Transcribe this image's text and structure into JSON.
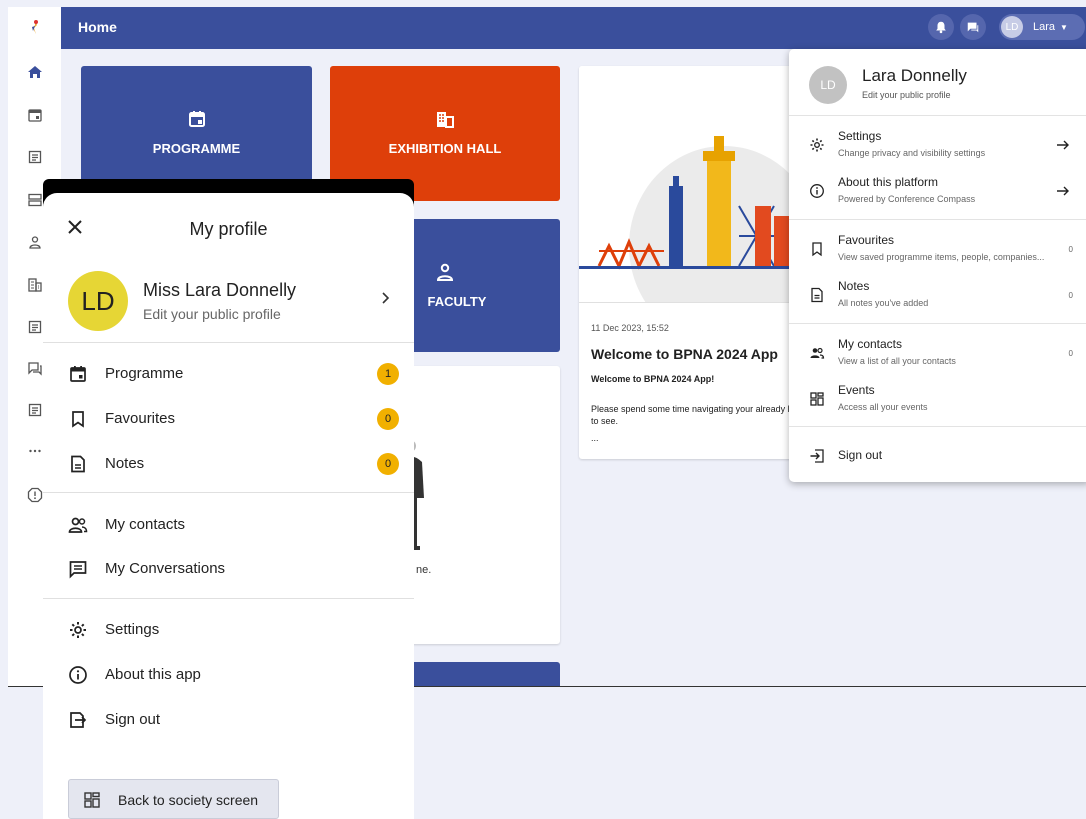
{
  "header": {
    "title": "Home",
    "user_initials": "LD",
    "user_name": "Lara"
  },
  "sidebar": {
    "items": [
      "logo-icon",
      "home-icon",
      "calendar-icon",
      "document-icon",
      "server-icon",
      "person-icon",
      "building-icon",
      "document-icon",
      "chat-icon",
      "document-icon",
      "more-icon",
      "alert-icon"
    ]
  },
  "tiles": {
    "programme": "PROGRAMME",
    "exhibition": "EXHIBITION HALL",
    "faculty": "FACULTY"
  },
  "card_white_text": "ne.",
  "news": {
    "date": "11 Dec 2023, 15:52",
    "title": "Welcome to BPNA 2024 App",
    "subtitle": "Welcome to BPNA 2024 App!",
    "body": "Please spend some time navigating your already lots to see.",
    "ellipsis": "..."
  },
  "user_menu": {
    "initials": "LD",
    "name": "Lara Donnelly",
    "edit": "Edit your public profile",
    "items": [
      {
        "label": "Settings",
        "sub": "Change privacy and visibility settings",
        "icon": "gear-icon"
      },
      {
        "label": "About this platform",
        "sub": "Powered by Conference Compass",
        "icon": "info-icon"
      },
      {
        "label": "Favourites",
        "sub": "View saved programme items, people, companies...",
        "count": "0",
        "icon": "bookmark-icon"
      },
      {
        "label": "Notes",
        "sub": "All notes you've added",
        "count": "0",
        "icon": "note-icon"
      },
      {
        "label": "My contacts",
        "sub": "View a list of all your contacts",
        "count": "0",
        "icon": "contacts-icon"
      },
      {
        "label": "Events",
        "sub": "Access all your events",
        "icon": "events-icon"
      },
      {
        "label": "Sign out",
        "icon": "sign-out-icon"
      }
    ]
  },
  "mobile": {
    "title": "My profile",
    "initials": "LD",
    "name": "Miss Lara Donnelly",
    "edit": "Edit your public profile",
    "items": [
      {
        "label": "Programme",
        "badge": "1",
        "icon": "calendar-icon"
      },
      {
        "label": "Favourites",
        "badge": "0",
        "icon": "bookmark-icon"
      },
      {
        "label": "Notes",
        "badge": "0",
        "icon": "note-icon"
      },
      {
        "label": "My contacts",
        "icon": "contacts-icon"
      },
      {
        "label": "My Conversations",
        "icon": "chat-icon"
      },
      {
        "label": "Settings",
        "icon": "gear-icon"
      },
      {
        "label": "About this app",
        "icon": "info-icon"
      },
      {
        "label": "Sign out",
        "icon": "sign-out-icon"
      }
    ],
    "back_button": "Back to society screen"
  }
}
